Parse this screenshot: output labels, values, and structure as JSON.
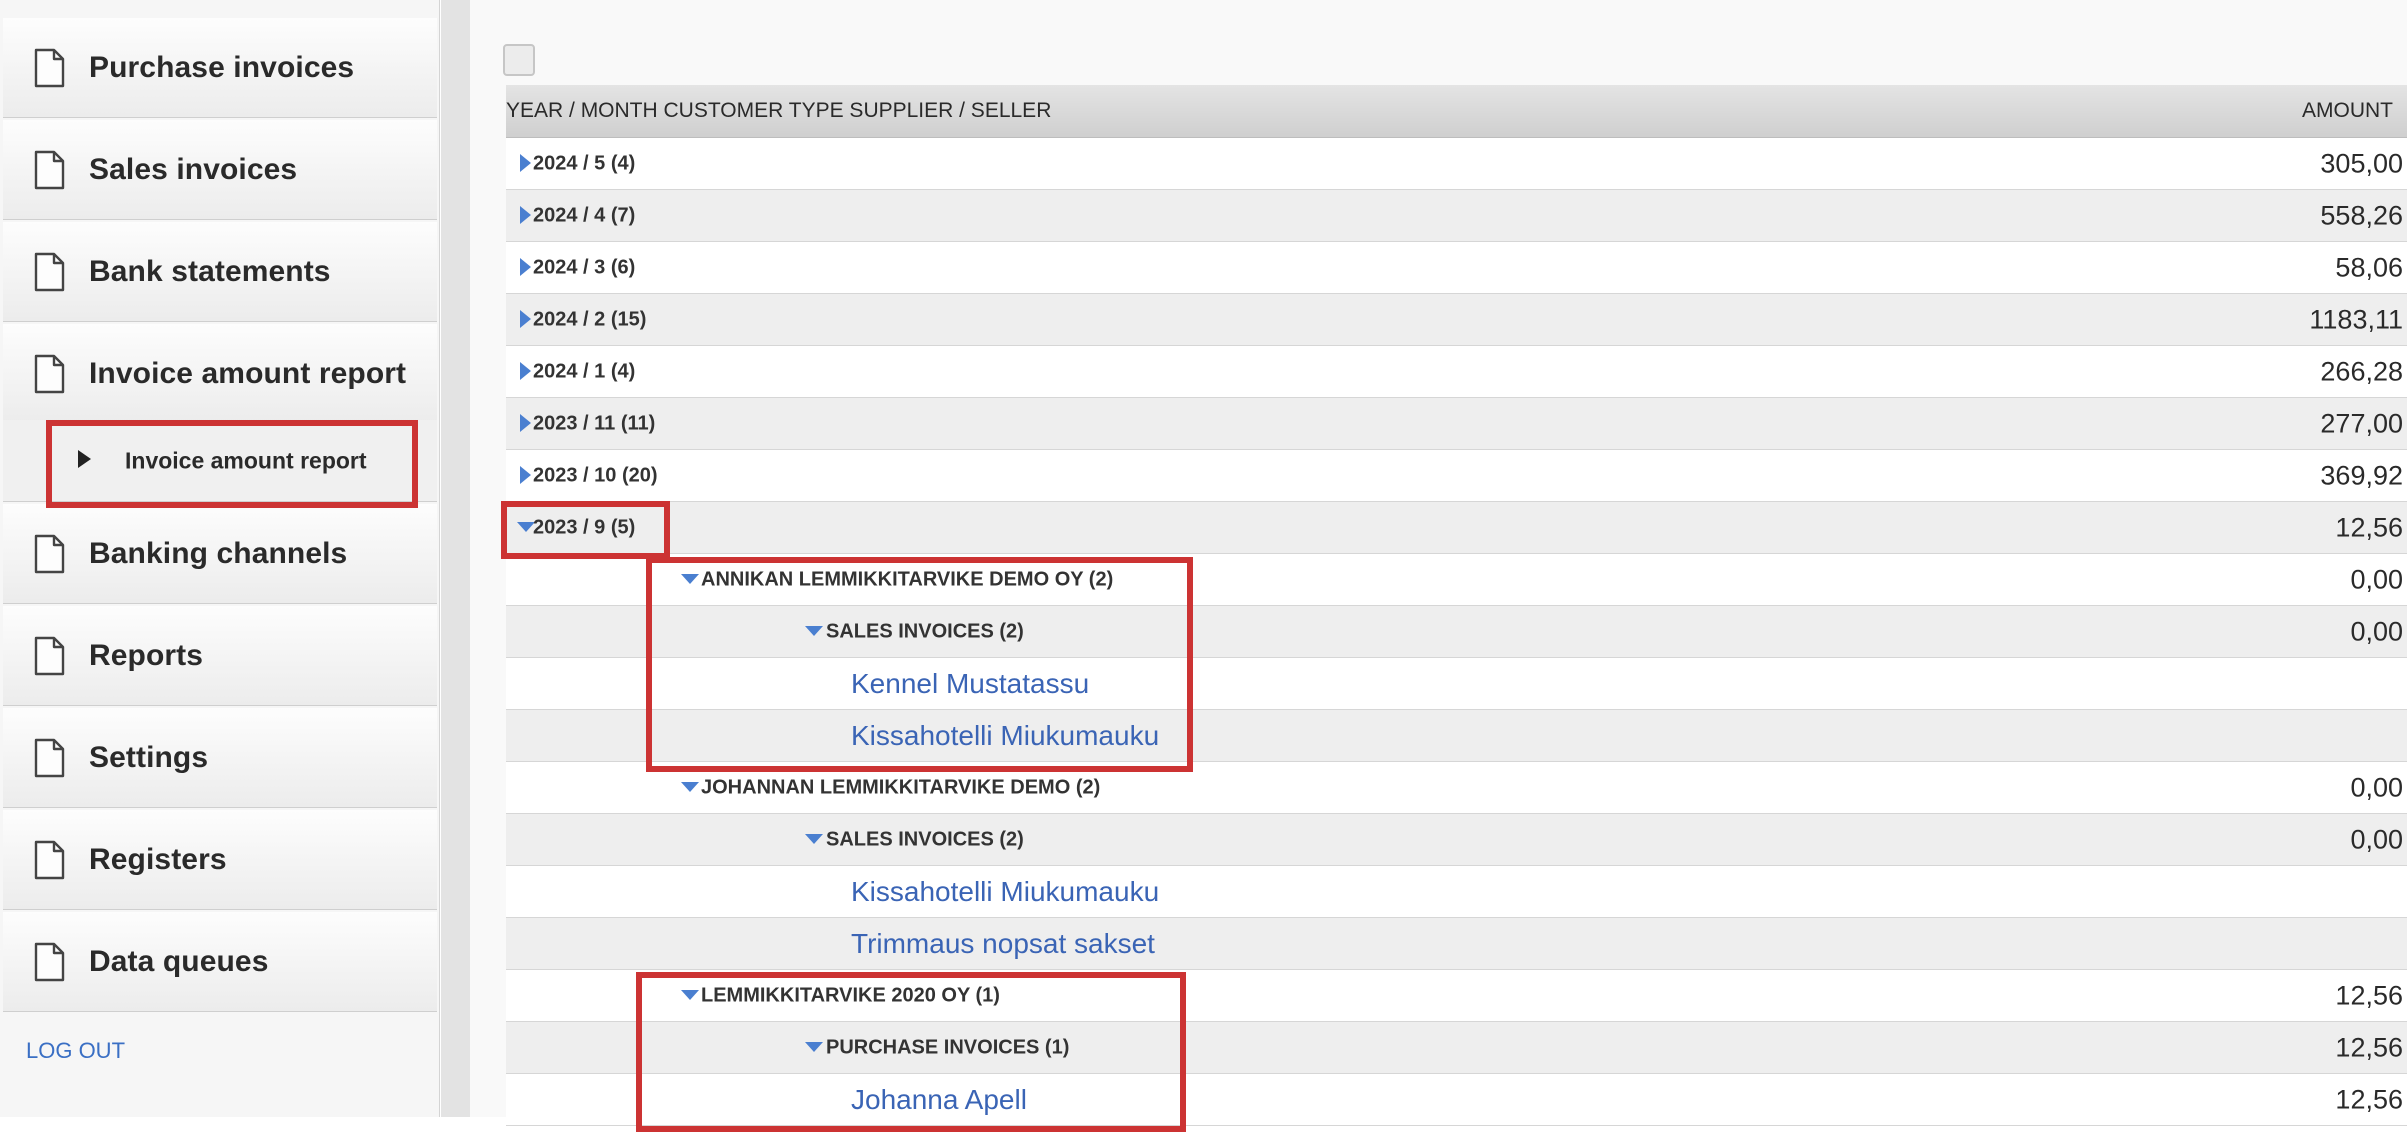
{
  "sidebar": {
    "items": [
      {
        "label": "Purchase invoices"
      },
      {
        "label": "Sales invoices"
      },
      {
        "label": "Bank statements"
      },
      {
        "label": "Invoice amount report"
      },
      {
        "label": "Banking channels"
      },
      {
        "label": "Reports"
      },
      {
        "label": "Settings"
      },
      {
        "label": "Registers"
      },
      {
        "label": "Data queues"
      }
    ],
    "sub_item": {
      "label": "Invoice amount report"
    },
    "logout_label": "LOG OUT"
  },
  "table": {
    "headers": {
      "group": "YEAR / MONTH CUSTOMER TYPE SUPPLIER / SELLER",
      "amount": "AMOUNT"
    },
    "rows": [
      {
        "label": "2024 / 5 (4)",
        "amount": "305,00",
        "state": "collapsed",
        "level": 0
      },
      {
        "label": "2024 / 4 (7)",
        "amount": "558,26",
        "state": "collapsed",
        "level": 0
      },
      {
        "label": "2024 / 3 (6)",
        "amount": "58,06",
        "state": "collapsed",
        "level": 0
      },
      {
        "label": "2024 / 2 (15)",
        "amount": "1183,11",
        "state": "collapsed",
        "level": 0
      },
      {
        "label": "2024 / 1 (4)",
        "amount": "266,28",
        "state": "collapsed",
        "level": 0
      },
      {
        "label": "2023 / 11 (11)",
        "amount": "277,00",
        "state": "collapsed",
        "level": 0
      },
      {
        "label": "2023 / 10 (20)",
        "amount": "369,92",
        "state": "collapsed",
        "level": 0
      },
      {
        "label": "2023 / 9 (5)",
        "amount": "12,56",
        "state": "expanded",
        "level": 0
      },
      {
        "label": "ANNIKAN LEMMIKKITARVIKE DEMO OY (2)",
        "amount": "0,00",
        "state": "expanded",
        "level": 1
      },
      {
        "label": "SALES INVOICES (2)",
        "amount": "0,00",
        "state": "expanded",
        "level": 2
      },
      {
        "label": "Kennel Mustatassu",
        "amount": "",
        "state": "leaf",
        "level": 3
      },
      {
        "label": "Kissahotelli Miukumauku",
        "amount": "",
        "state": "leaf",
        "level": 3
      },
      {
        "label": "JOHANNAN LEMMIKKITARVIKE DEMO (2)",
        "amount": "0,00",
        "state": "expanded",
        "level": 1
      },
      {
        "label": "SALES INVOICES (2)",
        "amount": "0,00",
        "state": "expanded",
        "level": 2
      },
      {
        "label": "Kissahotelli Miukumauku",
        "amount": "",
        "state": "leaf",
        "level": 3
      },
      {
        "label": "Trimmaus nopsat sakset",
        "amount": "",
        "state": "leaf",
        "level": 3
      },
      {
        "label": "LEMMIKKITARVIKE 2020 OY (1)",
        "amount": "12,56",
        "state": "expanded",
        "level": 1
      },
      {
        "label": "PURCHASE INVOICES (1)",
        "amount": "12,56",
        "state": "expanded",
        "level": 2
      },
      {
        "label": "Johanna Apell",
        "amount": "12,56",
        "state": "leaf",
        "level": 3
      }
    ]
  },
  "colors": {
    "highlight": "#cc3333",
    "link": "#3a64b5",
    "triangle": "#4a7fd0"
  },
  "icons": {
    "nav": "document-icon",
    "sub_nav": "play-triangle-icon",
    "collapsed": "triangle-right-icon",
    "expanded": "triangle-down-icon"
  }
}
